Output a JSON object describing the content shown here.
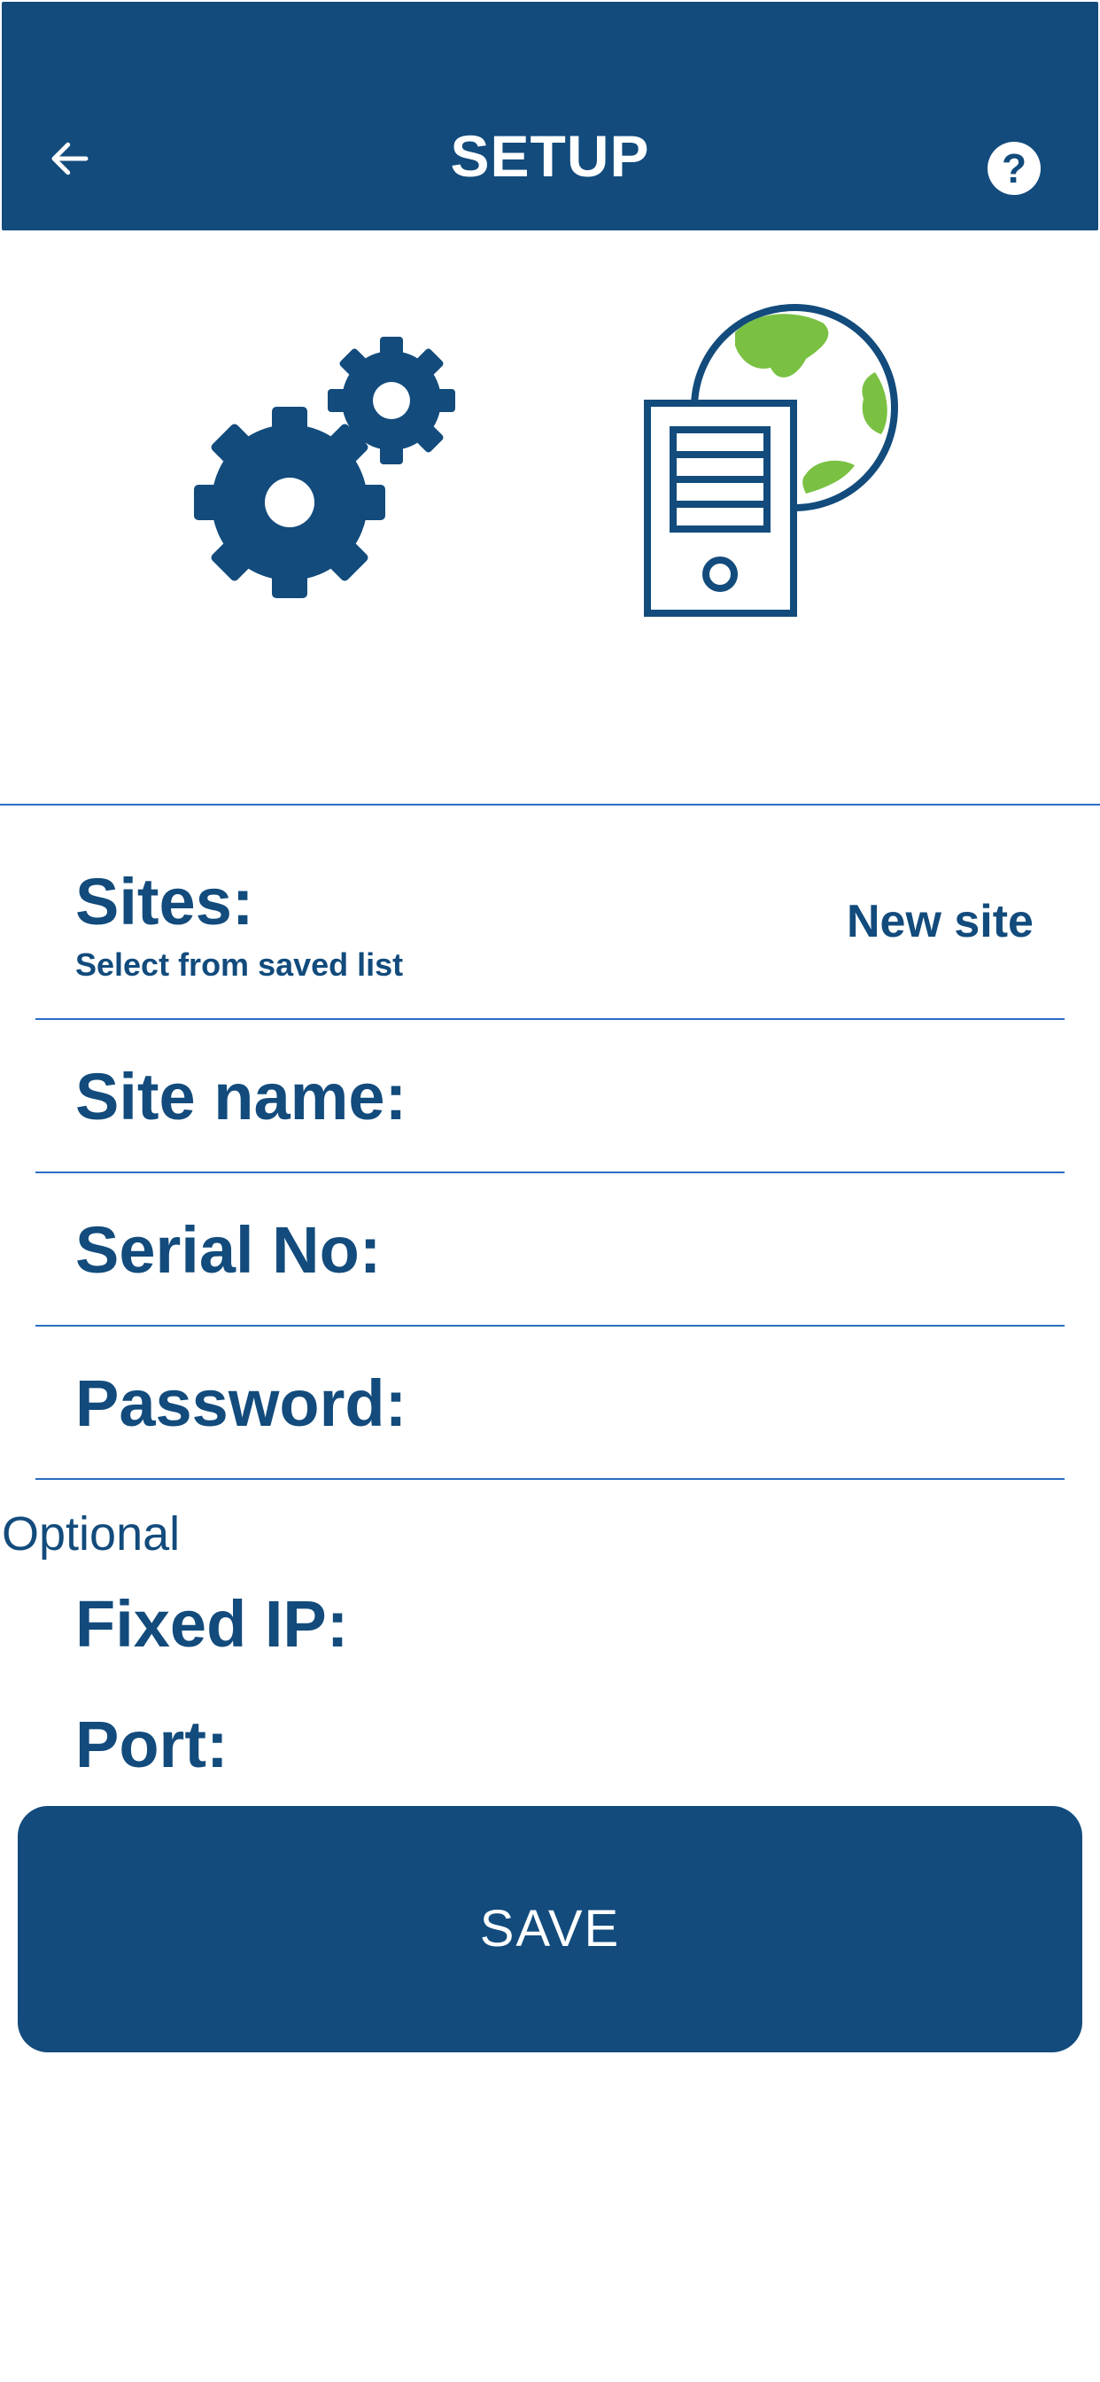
{
  "header": {
    "title": "SETUP",
    "back_icon": "arrow-left-icon",
    "help_icon": "help-icon",
    "help_glyph": "?"
  },
  "illustration": {
    "left_icon": "gears-icon",
    "right_icon": "server-globe-icon"
  },
  "form": {
    "sites": {
      "label": "Sites:",
      "sublabel": "Select from saved list",
      "action": "New site"
    },
    "site_name": {
      "label": "Site name:",
      "value": ""
    },
    "serial_no": {
      "label": "Serial No:",
      "value": ""
    },
    "password": {
      "label": "Password:",
      "value": ""
    },
    "optional_label": "Optional",
    "fixed_ip": {
      "label": "Fixed IP:",
      "value": ""
    },
    "port": {
      "label": "Port:",
      "value": ""
    }
  },
  "save_button": {
    "label": "SAVE"
  },
  "colors": {
    "primary": "#124b7c",
    "divider": "#2b6dc2",
    "globe_land": "#7ac143",
    "background": "#ffffff"
  }
}
